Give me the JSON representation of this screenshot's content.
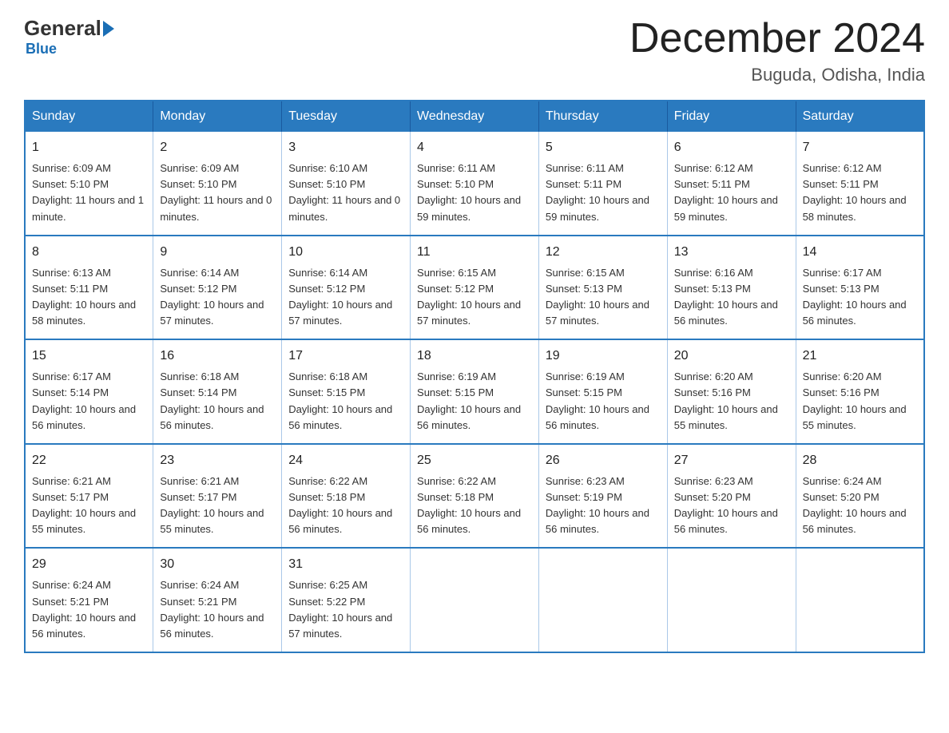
{
  "header": {
    "logo": {
      "general": "General",
      "blue": "Blue"
    },
    "title": "December 2024",
    "location": "Buguda, Odisha, India"
  },
  "days_of_week": [
    "Sunday",
    "Monday",
    "Tuesday",
    "Wednesday",
    "Thursday",
    "Friday",
    "Saturday"
  ],
  "weeks": [
    [
      {
        "day": "1",
        "sunrise": "6:09 AM",
        "sunset": "5:10 PM",
        "daylight": "11 hours and 1 minute."
      },
      {
        "day": "2",
        "sunrise": "6:09 AM",
        "sunset": "5:10 PM",
        "daylight": "11 hours and 0 minutes."
      },
      {
        "day": "3",
        "sunrise": "6:10 AM",
        "sunset": "5:10 PM",
        "daylight": "11 hours and 0 minutes."
      },
      {
        "day": "4",
        "sunrise": "6:11 AM",
        "sunset": "5:10 PM",
        "daylight": "10 hours and 59 minutes."
      },
      {
        "day": "5",
        "sunrise": "6:11 AM",
        "sunset": "5:11 PM",
        "daylight": "10 hours and 59 minutes."
      },
      {
        "day": "6",
        "sunrise": "6:12 AM",
        "sunset": "5:11 PM",
        "daylight": "10 hours and 59 minutes."
      },
      {
        "day": "7",
        "sunrise": "6:12 AM",
        "sunset": "5:11 PM",
        "daylight": "10 hours and 58 minutes."
      }
    ],
    [
      {
        "day": "8",
        "sunrise": "6:13 AM",
        "sunset": "5:11 PM",
        "daylight": "10 hours and 58 minutes."
      },
      {
        "day": "9",
        "sunrise": "6:14 AM",
        "sunset": "5:12 PM",
        "daylight": "10 hours and 57 minutes."
      },
      {
        "day": "10",
        "sunrise": "6:14 AM",
        "sunset": "5:12 PM",
        "daylight": "10 hours and 57 minutes."
      },
      {
        "day": "11",
        "sunrise": "6:15 AM",
        "sunset": "5:12 PM",
        "daylight": "10 hours and 57 minutes."
      },
      {
        "day": "12",
        "sunrise": "6:15 AM",
        "sunset": "5:13 PM",
        "daylight": "10 hours and 57 minutes."
      },
      {
        "day": "13",
        "sunrise": "6:16 AM",
        "sunset": "5:13 PM",
        "daylight": "10 hours and 56 minutes."
      },
      {
        "day": "14",
        "sunrise": "6:17 AM",
        "sunset": "5:13 PM",
        "daylight": "10 hours and 56 minutes."
      }
    ],
    [
      {
        "day": "15",
        "sunrise": "6:17 AM",
        "sunset": "5:14 PM",
        "daylight": "10 hours and 56 minutes."
      },
      {
        "day": "16",
        "sunrise": "6:18 AM",
        "sunset": "5:14 PM",
        "daylight": "10 hours and 56 minutes."
      },
      {
        "day": "17",
        "sunrise": "6:18 AM",
        "sunset": "5:15 PM",
        "daylight": "10 hours and 56 minutes."
      },
      {
        "day": "18",
        "sunrise": "6:19 AM",
        "sunset": "5:15 PM",
        "daylight": "10 hours and 56 minutes."
      },
      {
        "day": "19",
        "sunrise": "6:19 AM",
        "sunset": "5:15 PM",
        "daylight": "10 hours and 56 minutes."
      },
      {
        "day": "20",
        "sunrise": "6:20 AM",
        "sunset": "5:16 PM",
        "daylight": "10 hours and 55 minutes."
      },
      {
        "day": "21",
        "sunrise": "6:20 AM",
        "sunset": "5:16 PM",
        "daylight": "10 hours and 55 minutes."
      }
    ],
    [
      {
        "day": "22",
        "sunrise": "6:21 AM",
        "sunset": "5:17 PM",
        "daylight": "10 hours and 55 minutes."
      },
      {
        "day": "23",
        "sunrise": "6:21 AM",
        "sunset": "5:17 PM",
        "daylight": "10 hours and 55 minutes."
      },
      {
        "day": "24",
        "sunrise": "6:22 AM",
        "sunset": "5:18 PM",
        "daylight": "10 hours and 56 minutes."
      },
      {
        "day": "25",
        "sunrise": "6:22 AM",
        "sunset": "5:18 PM",
        "daylight": "10 hours and 56 minutes."
      },
      {
        "day": "26",
        "sunrise": "6:23 AM",
        "sunset": "5:19 PM",
        "daylight": "10 hours and 56 minutes."
      },
      {
        "day": "27",
        "sunrise": "6:23 AM",
        "sunset": "5:20 PM",
        "daylight": "10 hours and 56 minutes."
      },
      {
        "day": "28",
        "sunrise": "6:24 AM",
        "sunset": "5:20 PM",
        "daylight": "10 hours and 56 minutes."
      }
    ],
    [
      {
        "day": "29",
        "sunrise": "6:24 AM",
        "sunset": "5:21 PM",
        "daylight": "10 hours and 56 minutes."
      },
      {
        "day": "30",
        "sunrise": "6:24 AM",
        "sunset": "5:21 PM",
        "daylight": "10 hours and 56 minutes."
      },
      {
        "day": "31",
        "sunrise": "6:25 AM",
        "sunset": "5:22 PM",
        "daylight": "10 hours and 57 minutes."
      },
      null,
      null,
      null,
      null
    ]
  ]
}
